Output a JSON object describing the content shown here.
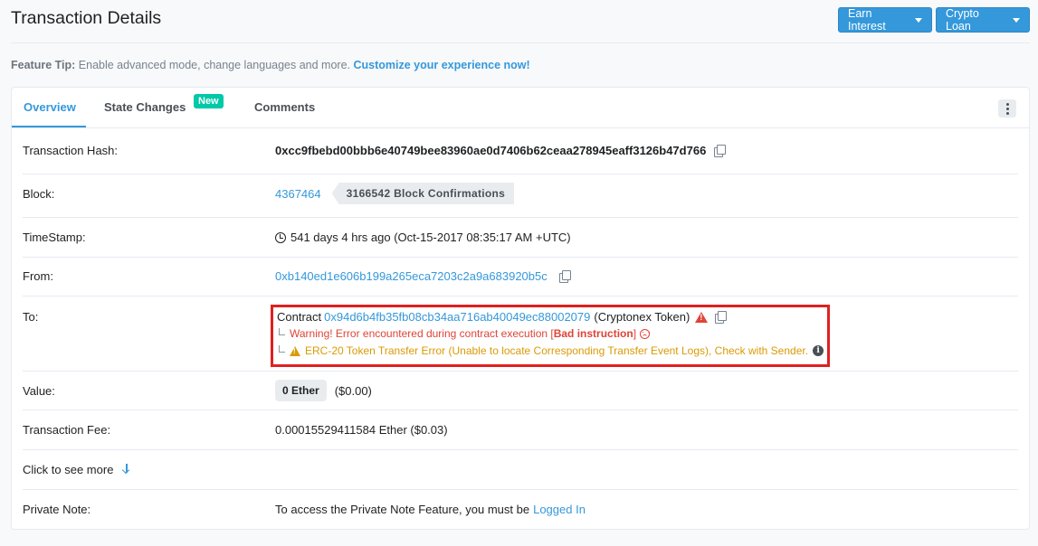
{
  "header": {
    "title": "Transaction Details",
    "earn_interest": "Earn Interest",
    "crypto_loan": "Crypto Loan"
  },
  "tip": {
    "label": "Feature Tip:",
    "text": " Enable advanced mode, change languages and more. ",
    "link": "Customize your experience now!"
  },
  "tabs": {
    "overview": "Overview",
    "state_changes": "State Changes",
    "new_badge": "New",
    "comments": "Comments"
  },
  "details": {
    "hash": {
      "label": "Transaction Hash:",
      "value": "0xcc9fbebd00bbb6e40749bee83960ae0d7406b62ceaa278945eaff3126b47d766"
    },
    "block": {
      "label": "Block:",
      "value": "4367464",
      "confirmations": "3166542 Block Confirmations"
    },
    "timestamp": {
      "label": "TimeStamp:",
      "value": "541 days 4 hrs ago (Oct-15-2017 08:35:17 AM +UTC)"
    },
    "from": {
      "label": "From:",
      "value": "0xb140ed1e606b199a265eca7203c2a9a683920b5c"
    },
    "to": {
      "label": "To:",
      "contract_prefix": "Contract ",
      "address": "0x94d6b4fb35fb08cb34aa716ab40049ec88002079",
      "token_name": " (Cryptonex Token)",
      "warning_text": "Warning! Error encountered during contract execution [",
      "warning_bold": "Bad instruction",
      "warning_end": "]",
      "erc20_error": "ERC-20 Token Transfer Error (Unable to locate Corresponding Transfer Event Logs), Check with Sender."
    },
    "value": {
      "label": "Value:",
      "ether": "0 Ether",
      "usd": "($0.00)"
    },
    "fee": {
      "label": "Transaction Fee:",
      "value": "0.00015529411584 Ether ($0.03)"
    },
    "see_more": "Click to see more",
    "note": {
      "label": "Private Note:",
      "text": "To access the Private Note Feature, you must be ",
      "link": "Logged In"
    }
  },
  "colors": {
    "accent": "#3498db",
    "error": "#de4437",
    "warning": "#db9a04",
    "highlight_box": "#e02020",
    "new_badge": "#00c9a7"
  }
}
